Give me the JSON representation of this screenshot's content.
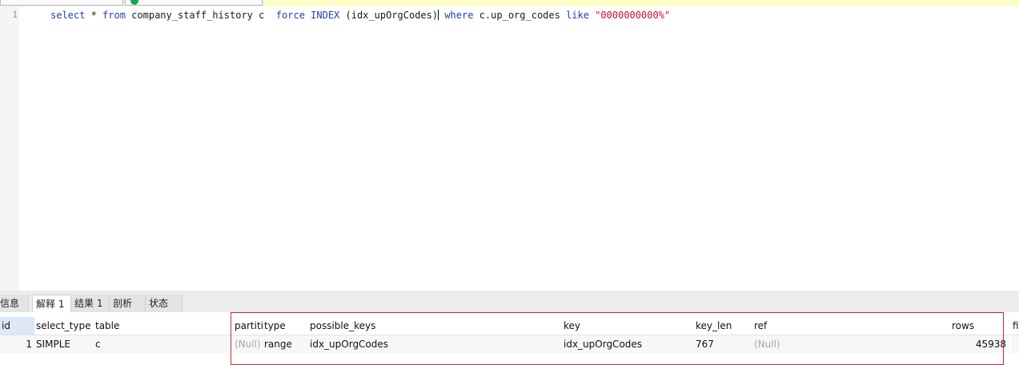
{
  "editor": {
    "line_number": "1",
    "sql": {
      "p1": "select",
      "p2": " * ",
      "p3": "from",
      "p4": " company_staff_history c  ",
      "p5": "force INDEX",
      "p6": " (idx_upOrgCodes)",
      "p7": " where",
      "p8": " c.up_org_codes ",
      "p9": "like",
      "p10": " ",
      "p11": "\"0000000000%\""
    }
  },
  "result_tabs": [
    "信息",
    "解释 1",
    "结果 1",
    "剖析",
    "状态"
  ],
  "active_tab": "解释 1",
  "columns": [
    "id",
    "select_type",
    "table",
    "partiti",
    "type",
    "possible_keys",
    "key",
    "key_len",
    "ref",
    "rows",
    "fil"
  ],
  "rows": [
    {
      "id": "1",
      "select_type": "SIMPLE",
      "table": "c",
      "partitions": "(Null)",
      "type": "range",
      "possible_keys": "idx_upOrgCodes",
      "key": "idx_upOrgCodes",
      "key_len": "767",
      "ref": "(Null)",
      "rows": "45938",
      "filtered": ""
    }
  ],
  "colors": {
    "keyword": "#1f3fb8",
    "string": "#c8102e",
    "highlight_box": "#c92a32",
    "selected_header": "#dce8f7"
  }
}
